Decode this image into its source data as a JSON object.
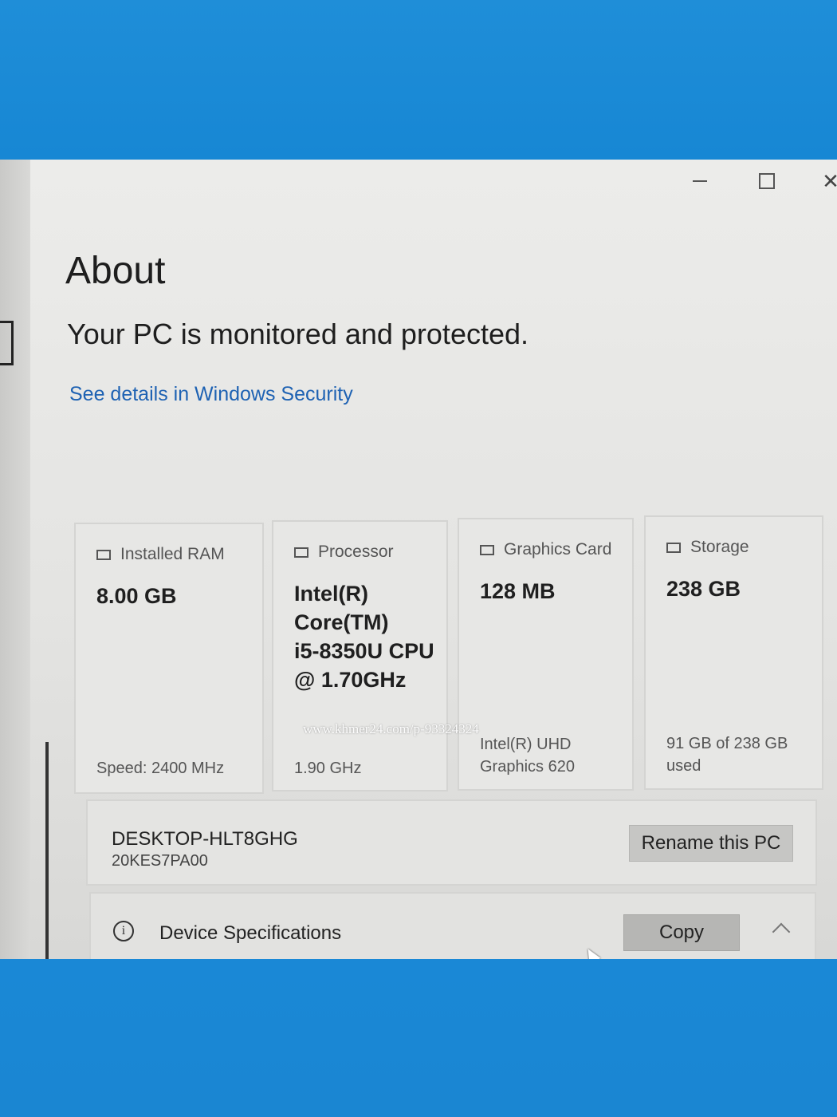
{
  "window": {
    "controls": {
      "minimize": "minimize",
      "maximize": "maximize",
      "close": "close"
    }
  },
  "about": {
    "title": "About",
    "status": "Your PC is monitored and protected.",
    "security_link": "See details in Windows Security"
  },
  "cards": [
    {
      "label": "Installed RAM",
      "value": "8.00 GB",
      "footer": "Speed: 2400 MHz"
    },
    {
      "label": "Processor",
      "value": "Intel(R)\nCore(TM)\ni5-8350U CPU\n@ 1.70GHz",
      "footer": "1.90 GHz"
    },
    {
      "label": "Graphics Card",
      "value": "128 MB",
      "footer": "Intel(R) UHD\nGraphics 620"
    },
    {
      "label": "Storage",
      "value": "238 GB",
      "footer": "91 GB of 238 GB\nused"
    }
  ],
  "pc": {
    "name": "DESKTOP-HLT8GHG",
    "model": "20KES7PA00",
    "rename_label": "Rename this PC"
  },
  "device_specs": {
    "info_icon": "i",
    "label": "Device Specifications",
    "copy_label": "Copy"
  },
  "watermark": "www.khmer24.com/p-93324324"
}
